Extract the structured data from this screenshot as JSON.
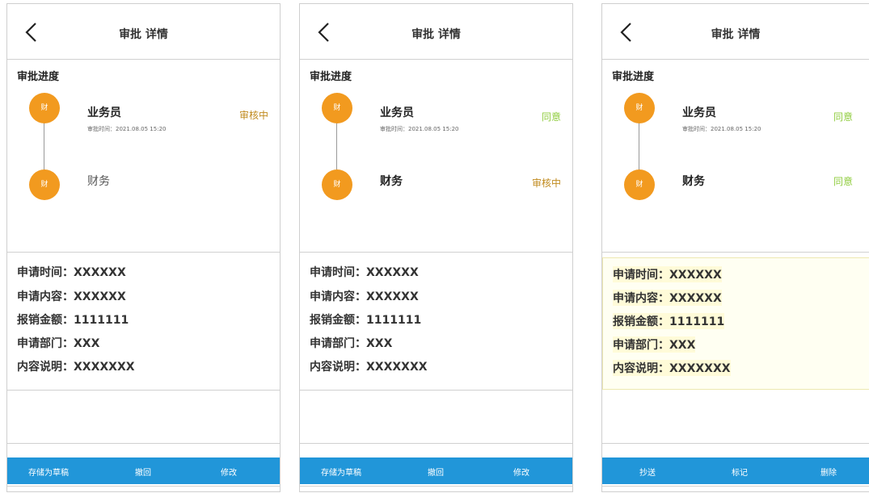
{
  "screens": [
    {
      "title": "审批 详情",
      "section_title": "审批进度",
      "steps": [
        {
          "avatar": "财",
          "name": "业务员",
          "time": "审批时间：2021.08.05 15:20",
          "status": "审核中"
        },
        {
          "avatar": "财",
          "name": "财务",
          "status": ""
        }
      ],
      "details": [
        "申请时间：XXXXXX",
        "申请内容：XXXXXX",
        "报销金额：1111111",
        "申请部门：XXX",
        "内容说明：XXXXXXX"
      ],
      "actions": [
        "存储为草稿",
        "撤回",
        "修改"
      ]
    },
    {
      "title": "审批 详情",
      "section_title": "审批进度",
      "steps": [
        {
          "avatar": "财",
          "name": "业务员",
          "time": "审批时间：2021.08.05 15:20",
          "status": "同意"
        },
        {
          "avatar": "财",
          "name": "财务",
          "status": "审核中"
        }
      ],
      "details": [
        "申请时间：XXXXXX",
        "申请内容：XXXXXX",
        "报销金额：1111111",
        "申请部门：XXX",
        "内容说明：XXXXXXX"
      ],
      "actions": [
        "存储为草稿",
        "撤回",
        "修改"
      ]
    },
    {
      "title": "审批 详情",
      "section_title": "审批进度",
      "steps": [
        {
          "avatar": "财",
          "name": "业务员",
          "time": "审批时间：2021.08.05 15:20",
          "status": "同意"
        },
        {
          "avatar": "财",
          "name": "财务",
          "status": "同意"
        }
      ],
      "details": [
        "申请时间：XXXXXX",
        "申请内容：XXXXXX",
        "报销金额：1111111",
        "申请部门：XXX",
        "内容说明：XXXXXXX"
      ],
      "actions": [
        "抄送",
        "标记",
        "删除"
      ]
    }
  ],
  "colors": {
    "accent_orange": "#f29a1f",
    "action_bar_blue": "#2196d9",
    "status_approved": "#8fcc3e",
    "status_reviewing": "#c08a1d"
  },
  "icons": {
    "back": "chevron-left-icon"
  }
}
